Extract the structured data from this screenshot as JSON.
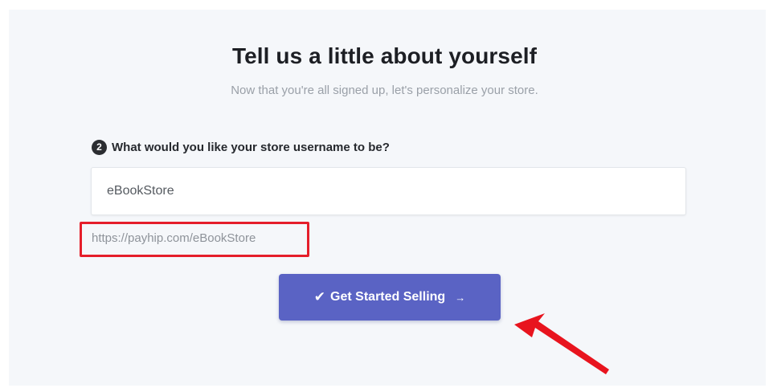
{
  "header": {
    "title": "Tell us a little about yourself",
    "subtitle": "Now that you're all signed up, let's personalize your store."
  },
  "form": {
    "step_number": "2",
    "question": "What would you like your store username to be?",
    "username_value": "eBookStore",
    "url_preview": "https://payhip.com/eBookStore"
  },
  "cta": {
    "check_glyph": "✔",
    "label": "Get Started Selling",
    "arrow_glyph": "→"
  },
  "colors": {
    "primary_button": "#5a63c4",
    "highlight_box": "#e51e2a",
    "annotation_arrow": "#e8141e"
  },
  "icons": {
    "check": "check-icon",
    "arrow": "arrow-right-icon",
    "annotation": "red-pointer-arrow"
  }
}
